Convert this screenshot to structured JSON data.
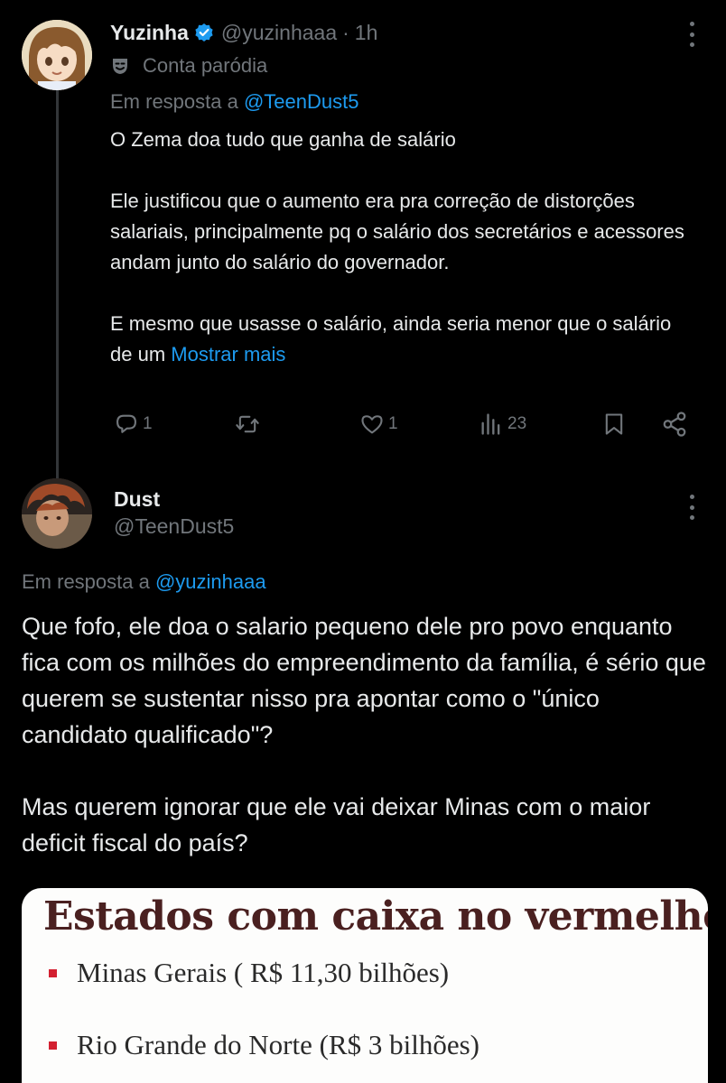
{
  "tweet1": {
    "name": "Yuzinha",
    "handle": "@yuzinhaaa",
    "separator": "·",
    "time": "1h",
    "parody_label": "Conta paródia",
    "reply_prefix": "Em resposta a",
    "reply_handle": "@TeenDust5",
    "body_line1": "O Zema doa tudo que ganha de salário",
    "body_para2": "Ele justificou que o aumento era pra correção de distorções salariais, principalmente pq o salário dos secretários e acessores andam junto do salário do governador.",
    "body_para3": "E mesmo que usasse o salário, ainda seria menor que o salário de um",
    "show_more": "Mostrar mais",
    "replies": "1",
    "likes": "1",
    "views": "23"
  },
  "tweet2": {
    "name": "Dust",
    "handle": "@TeenDust5",
    "reply_prefix": "Em resposta a",
    "reply_handle": "@yuzinhaaa",
    "body_para1": "Que fofo, ele doa o salario pequeno dele pro povo enquanto fica com os milhões do empreendimento da família, é sério que querem se sustentar nisso pra apontar como o \"único candidato qualificado\"?",
    "body_para2": "Mas querem ignorar que ele vai deixar Minas com o maior deficit fiscal do país?"
  },
  "media": {
    "title": "Estados com caixa no vermelho",
    "items": [
      "Minas Gerais ( R$ 11,30 bilhões)",
      "Rio Grande do Norte (R$ 3 bilhões)"
    ],
    "bullet_color": "#d32030"
  },
  "colors": {
    "background": "#000000",
    "text": "#e7e9ea",
    "secondary": "#71767b",
    "link": "#1d9bf0",
    "verified": "#1d9bf0"
  },
  "icons": {
    "verified": "verified-badge-icon",
    "parody": "theater-mask-icon",
    "reply": "reply-icon",
    "retweet": "retweet-icon",
    "like": "heart-icon",
    "views": "views-bar-chart-icon",
    "bookmark": "bookmark-icon",
    "share": "share-icon",
    "more": "more-vertical-icon"
  }
}
